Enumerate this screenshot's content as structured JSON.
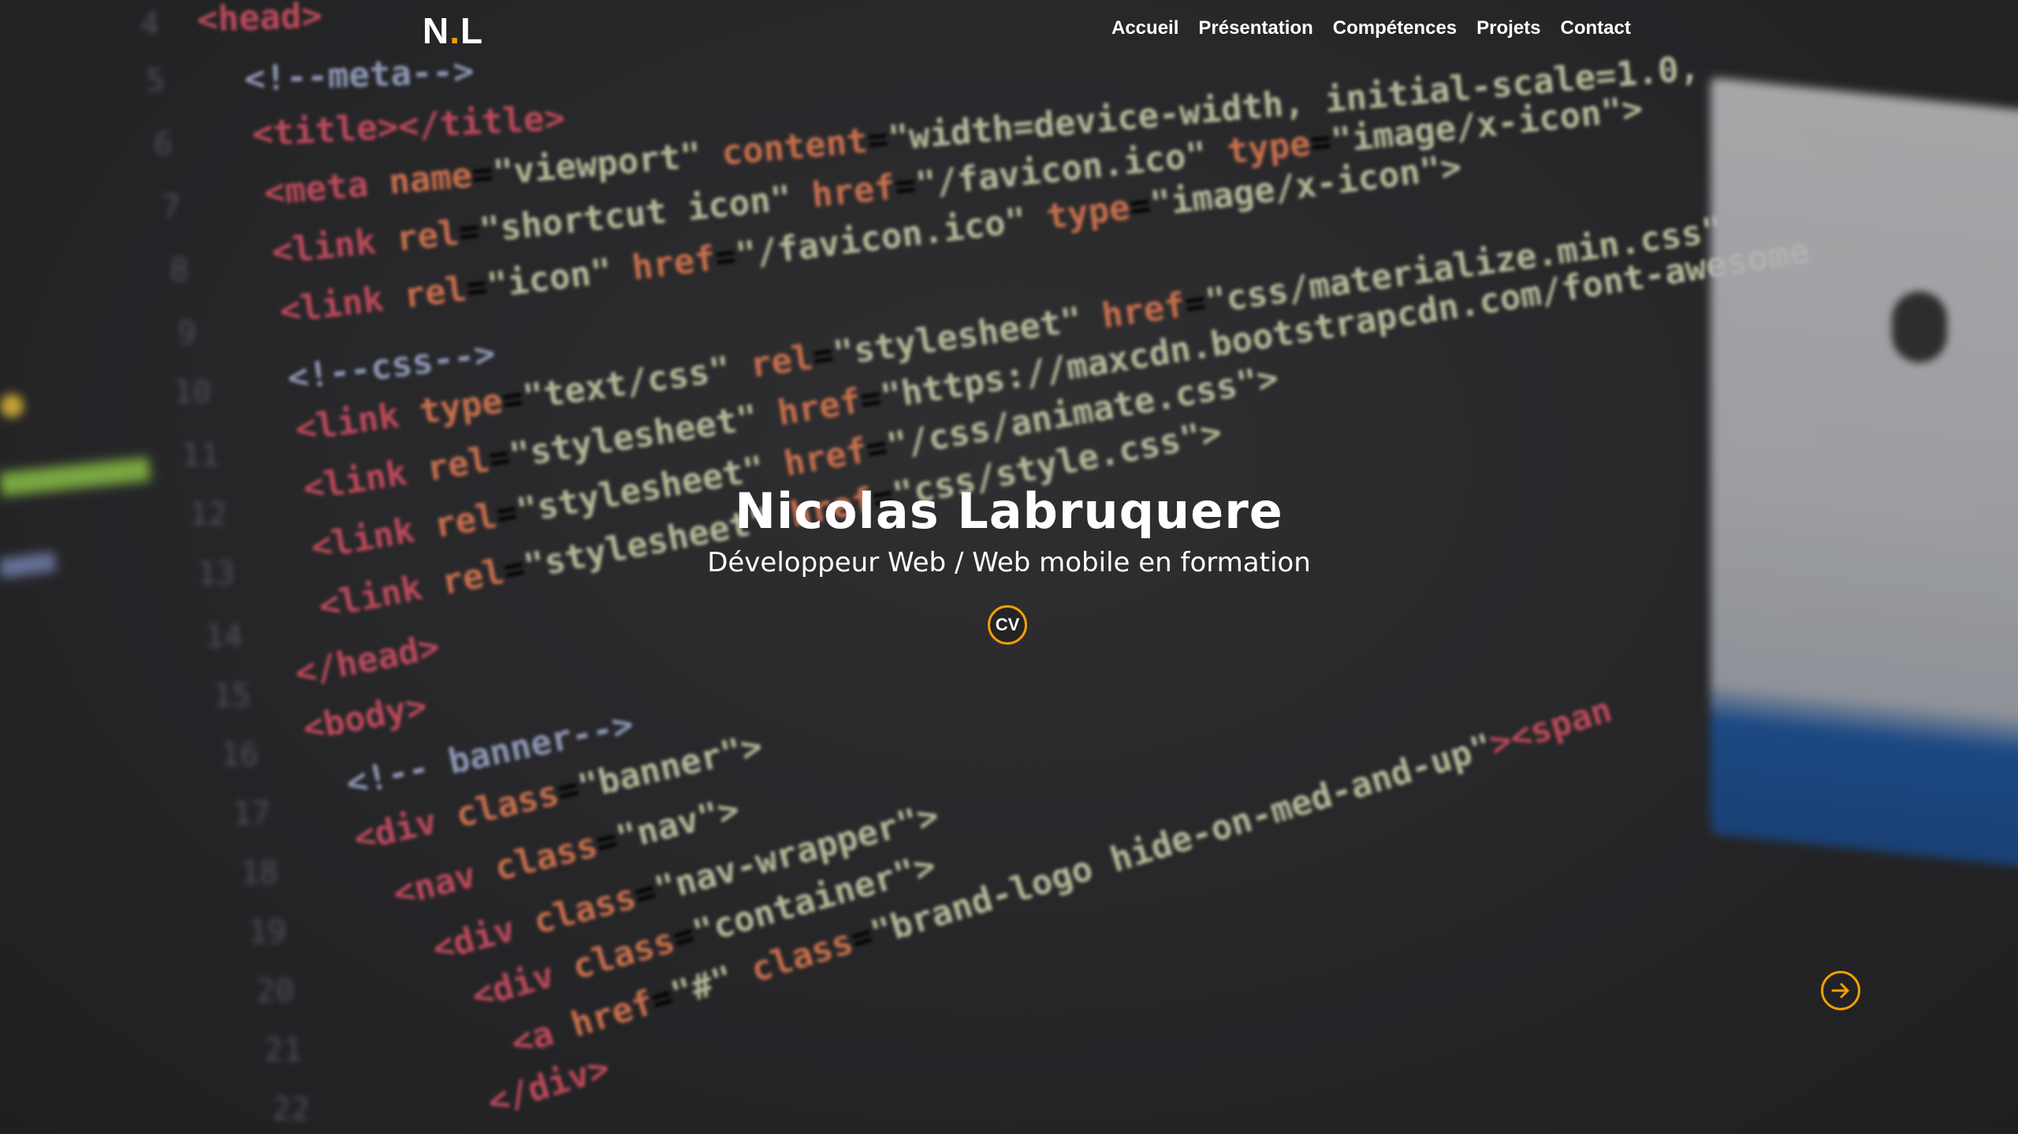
{
  "logo": {
    "left": "N",
    "dot": ".",
    "right": "L"
  },
  "nav": {
    "items": [
      {
        "label": "Accueil"
      },
      {
        "label": "Présentation"
      },
      {
        "label": "Compétences"
      },
      {
        "label": "Projets"
      },
      {
        "label": "Contact"
      }
    ]
  },
  "hero": {
    "name": "Nicolas Labruquere",
    "subtitle": "Développeur Web / Web mobile en formation",
    "cv_label": "CV"
  },
  "colors": {
    "accent": "#f5a000",
    "text": "#ffffff"
  },
  "icons": {
    "next": "arrow-right-circle-icon"
  }
}
